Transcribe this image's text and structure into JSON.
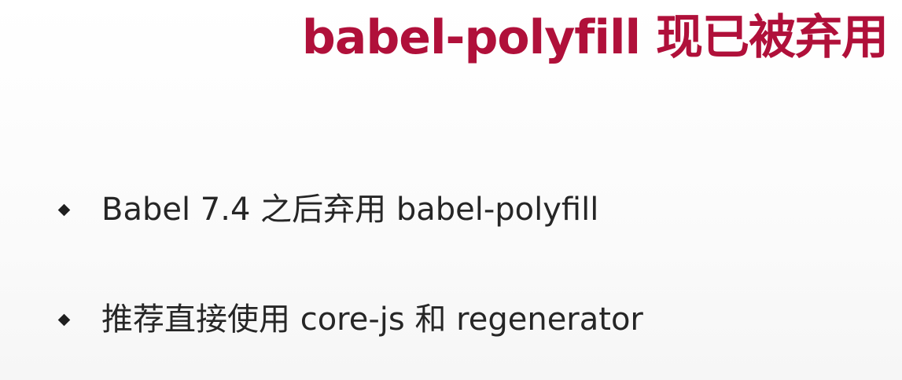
{
  "slide": {
    "title": "babel-polyfill 现已被弃用",
    "bullets": [
      {
        "text": "Babel 7.4 之后弃用 babel-polyfill"
      },
      {
        "text": "推荐直接使用 core-js 和 regenerator"
      }
    ],
    "colors": {
      "title": "#b0103a",
      "text": "#262626",
      "background": "#fdfdfd"
    }
  }
}
